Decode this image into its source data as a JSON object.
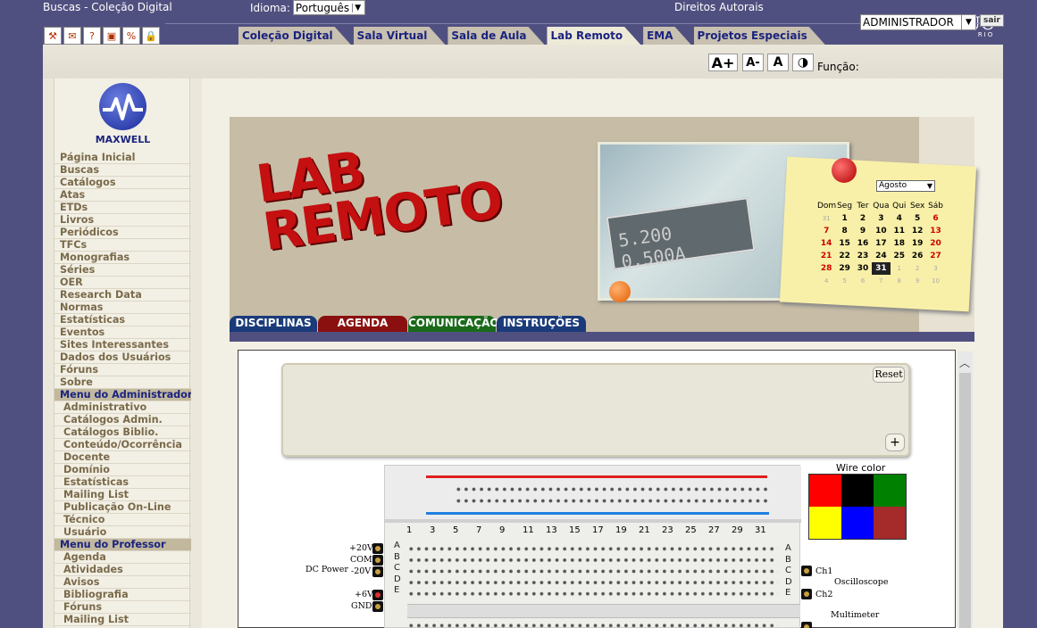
{
  "header": {
    "site_title": "Buscas - Coleção Digital",
    "language_label": "Idioma:",
    "language_value": "Português",
    "rights_link": "Direitos Autorais",
    "logo_puc": "PUC",
    "logo_rio": "RIO"
  },
  "main_tabs": [
    {
      "label": "Coleção Digital"
    },
    {
      "label": "Sala Virtual"
    },
    {
      "label": "Sala de Aula"
    },
    {
      "label": "Lab Remoto",
      "active": true
    },
    {
      "label": "EMA"
    },
    {
      "label": "Projetos Especiais"
    }
  ],
  "tool_icons": [
    "tools-icon",
    "mail-icon",
    "help-icon",
    "presentation-icon",
    "percent-icon",
    "lock-icon"
  ],
  "toolbar": {
    "font_increase": "A+",
    "font_decrease": "A-",
    "font_normal": "A",
    "contrast_icon": "contrast-icon",
    "role_label": "Função:",
    "role_value": "ADMINISTRADOR",
    "logout": "sair"
  },
  "sidebar": {
    "logo_text": "MAXWELL",
    "items": [
      {
        "label": "Página Inicial",
        "type": "item"
      },
      {
        "label": "Buscas",
        "type": "item"
      },
      {
        "label": "Catálogos",
        "type": "item"
      },
      {
        "label": "Atas",
        "type": "item"
      },
      {
        "label": "ETDs",
        "type": "item"
      },
      {
        "label": "Livros",
        "type": "item"
      },
      {
        "label": "Periódicos",
        "type": "item"
      },
      {
        "label": "TFCs",
        "type": "item"
      },
      {
        "label": "Monografias",
        "type": "item"
      },
      {
        "label": "Séries",
        "type": "item"
      },
      {
        "label": "OER",
        "type": "item"
      },
      {
        "label": "Research Data",
        "type": "item"
      },
      {
        "label": "Normas",
        "type": "item"
      },
      {
        "label": "Estatísticas",
        "type": "item"
      },
      {
        "label": "Eventos",
        "type": "item"
      },
      {
        "label": "Sites Interessantes",
        "type": "item"
      },
      {
        "label": "Dados dos Usuários",
        "type": "item"
      },
      {
        "label": "Fóruns",
        "type": "item"
      },
      {
        "label": "Sobre",
        "type": "item"
      },
      {
        "label": "Menu do Administrador",
        "type": "head"
      },
      {
        "label": "Administrativo",
        "type": "sub"
      },
      {
        "label": "Catálogos Admin.",
        "type": "sub"
      },
      {
        "label": "Catálogos Biblio.",
        "type": "sub"
      },
      {
        "label": "Conteúdo/Ocorrência",
        "type": "sub"
      },
      {
        "label": "Docente",
        "type": "sub"
      },
      {
        "label": "Domínio",
        "type": "sub"
      },
      {
        "label": "Estatísticas",
        "type": "sub"
      },
      {
        "label": "Mailing List",
        "type": "sub"
      },
      {
        "label": "Publicação On-Line",
        "type": "sub"
      },
      {
        "label": "Técnico",
        "type": "sub"
      },
      {
        "label": "Usuário",
        "type": "sub"
      },
      {
        "label": "Menu do Professor",
        "type": "head"
      },
      {
        "label": "Agenda",
        "type": "sub"
      },
      {
        "label": "Atividades",
        "type": "sub"
      },
      {
        "label": "Avisos",
        "type": "sub"
      },
      {
        "label": "Bibliografia",
        "type": "sub"
      },
      {
        "label": "Fóruns",
        "type": "sub"
      },
      {
        "label": "Mailing List",
        "type": "sub"
      }
    ]
  },
  "banner": {
    "title_line1": "LAB",
    "title_line2": "REMOTO",
    "display_left": "5.200",
    "display_right": "0.500A",
    "calendar": {
      "month": "Agosto",
      "weekdays": [
        "Dom",
        "Seg",
        "Ter",
        "Qua",
        "Qui",
        "Sex",
        "Sáb"
      ],
      "weeks": [
        [
          "31",
          "1",
          "2",
          "3",
          "4",
          "5",
          "6"
        ],
        [
          "7",
          "8",
          "9",
          "10",
          "11",
          "12",
          "13"
        ],
        [
          "14",
          "15",
          "16",
          "17",
          "18",
          "19",
          "20"
        ],
        [
          "21",
          "22",
          "23",
          "24",
          "25",
          "26",
          "27"
        ],
        [
          "28",
          "29",
          "30",
          "31",
          "1",
          "2",
          "3"
        ],
        [
          "4",
          "5",
          "6",
          "7",
          "8",
          "9",
          "10"
        ]
      ],
      "today": "31"
    }
  },
  "section_tabs": [
    {
      "label": "DISCIPLINAS",
      "color": "#1a3a7a"
    },
    {
      "label": "AGENDA",
      "color": "#8a1010"
    },
    {
      "label": "COMUNICAÇÃO",
      "color": "#1a6a1a"
    },
    {
      "label": "INSTRUÇÕES",
      "color": "#1a3a7a"
    }
  ],
  "lab": {
    "reset_label": "Reset",
    "add_label": "+",
    "wire_color_label": "Wire color",
    "wire_colors": [
      "#ff0000",
      "#000000",
      "#008000",
      "#ffff00",
      "#0000ff",
      "#a52a2a"
    ],
    "column_numbers": [
      "1",
      "3",
      "5",
      "7",
      "9",
      "11",
      "13",
      "15",
      "17",
      "19",
      "21",
      "23",
      "25",
      "27",
      "29",
      "31"
    ],
    "row_letters": [
      "A",
      "B",
      "C",
      "D",
      "E"
    ],
    "power_labels": {
      "p20": "+20V",
      "com": "COM",
      "m20": "-20V",
      "dc": "DC Power",
      "p6": "+6V",
      "gnd": "GND"
    },
    "scope_labels": {
      "ch1": "Ch1",
      "ch2": "Ch2",
      "osc": "Oscilloscope",
      "multi": "Multimeter"
    }
  }
}
